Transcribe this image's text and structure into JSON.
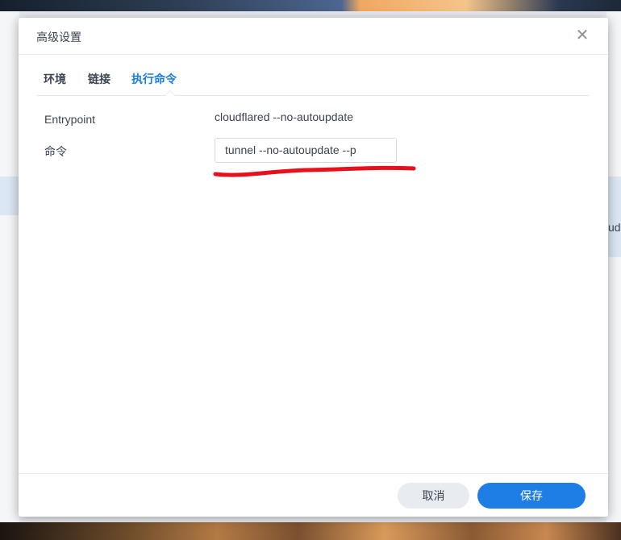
{
  "dialog": {
    "title": "高级设置",
    "close_glyph": "✕"
  },
  "tabs": [
    {
      "label": "环境",
      "active": false
    },
    {
      "label": "链接",
      "active": false
    },
    {
      "label": "执行命令",
      "active": true
    }
  ],
  "fields": {
    "entrypoint_label": "Entrypoint",
    "entrypoint_value": "cloudflared --no-autoupdate",
    "command_label": "命令",
    "command_value": "tunnel --no-autoupdate --p"
  },
  "annotation": {
    "type": "red-underline-mark",
    "color": "#e8101a"
  },
  "background": {
    "right_edge_fragment": "ud"
  },
  "footer": {
    "cancel_label": "取消",
    "save_label": "保存"
  },
  "colors": {
    "accent": "#1f7ee6",
    "active_tab": "#1a7be0",
    "text": "#3b4451"
  }
}
